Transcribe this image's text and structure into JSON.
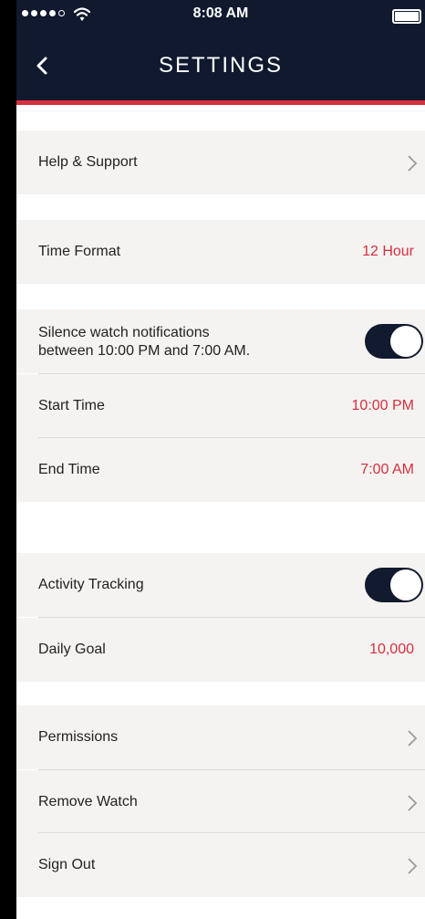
{
  "status_bar": {
    "time": "8:08 AM",
    "signal_dots": 5,
    "signal_bars_filled": 4,
    "icons": [
      "signal-dots-icon",
      "wifi-icon",
      "battery-icon"
    ]
  },
  "header": {
    "title": "SETTINGS",
    "back_icon": "chevron-left-icon"
  },
  "colors": {
    "nav_background": "#10192e",
    "accent_red": "#d72f3e",
    "row_background": "#f5f3f1",
    "toggle_on": "#111a2e"
  },
  "rows": {
    "help_support": {
      "label": "Help & Support",
      "icon": "chevron-right-icon"
    },
    "time_format": {
      "label": "Time Format",
      "value": "12 Hour"
    },
    "silence": {
      "label_line1": "Silence watch notifications",
      "label_line2": "between 10:00 PM and 7:00 AM.",
      "toggle_on": true
    },
    "start_time": {
      "label": "Start Time",
      "value": "10:00 PM"
    },
    "end_time": {
      "label": "End Time",
      "value": "7:00 AM"
    },
    "activity_tracking": {
      "label": "Activity Tracking",
      "toggle_on": true
    },
    "daily_goal": {
      "label": "Daily Goal",
      "value": "10,000"
    },
    "permissions": {
      "label": "Permissions",
      "icon": "chevron-right-icon"
    },
    "remove_watch": {
      "label": "Remove Watch",
      "icon": "chevron-right-icon"
    },
    "sign_out": {
      "label": "Sign Out",
      "icon": "chevron-right-icon"
    }
  }
}
